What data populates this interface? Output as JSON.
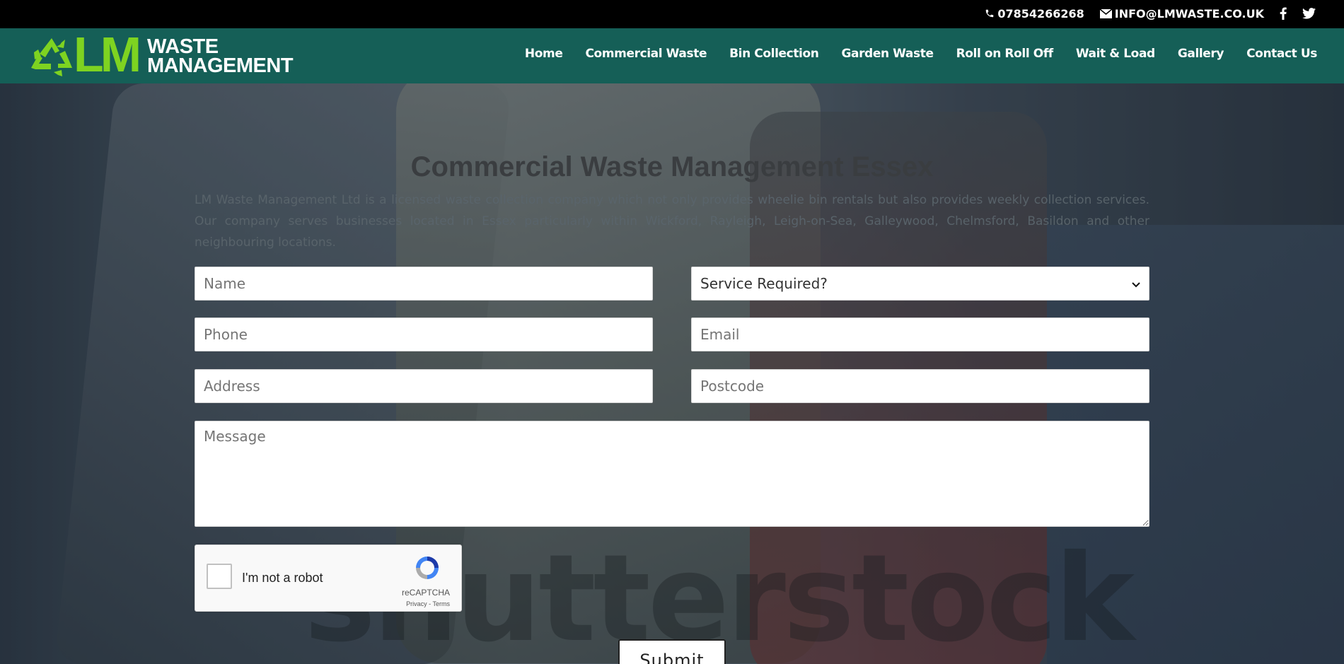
{
  "topbar": {
    "phone": "07854266268",
    "email": "INFO@LMWASTE.CO.UK",
    "icons": [
      "phone-icon",
      "mail-icon",
      "facebook-icon",
      "twitter-icon"
    ]
  },
  "logo": {
    "lm": "LM",
    "line1": "WASTE",
    "line2": "MANAGEMENT",
    "colors": {
      "lm": "#7ed321",
      "words": "#ffffff"
    }
  },
  "nav": {
    "items": [
      "Home",
      "Commercial Waste",
      "Bin Collection",
      "Garden Waste",
      "Roll on Roll Off",
      "Wait & Load",
      "Gallery",
      "Contact Us"
    ]
  },
  "section": {
    "title": "Commercial Waste Management Essex",
    "text": "LM Waste Management Ltd is a licensed waste collection company which not only provides wheelie bin rentals but also provides weekly collection services. Our company serves businesses located in Essex particularly within Wickford, Rayleigh, Leigh-on-Sea, Galleywood, Chelmsford, Basildon and other neighbouring locations."
  },
  "form": {
    "name_placeholder": "Name",
    "service_selected": "Service Required?",
    "phone_placeholder": "Phone",
    "email_placeholder": "Email",
    "address_placeholder": "Address",
    "postcode_placeholder": "Postcode",
    "message_placeholder": "Message",
    "submit_label": "Submit"
  },
  "captcha": {
    "label": "I'm not a robot",
    "brand": "reCAPTCHA",
    "links": "Privacy - Terms"
  },
  "background": {
    "watermark": "shutterstock"
  },
  "colors": {
    "topbar": "#000000",
    "header": "#155f57",
    "accent_green": "#7ed321"
  }
}
